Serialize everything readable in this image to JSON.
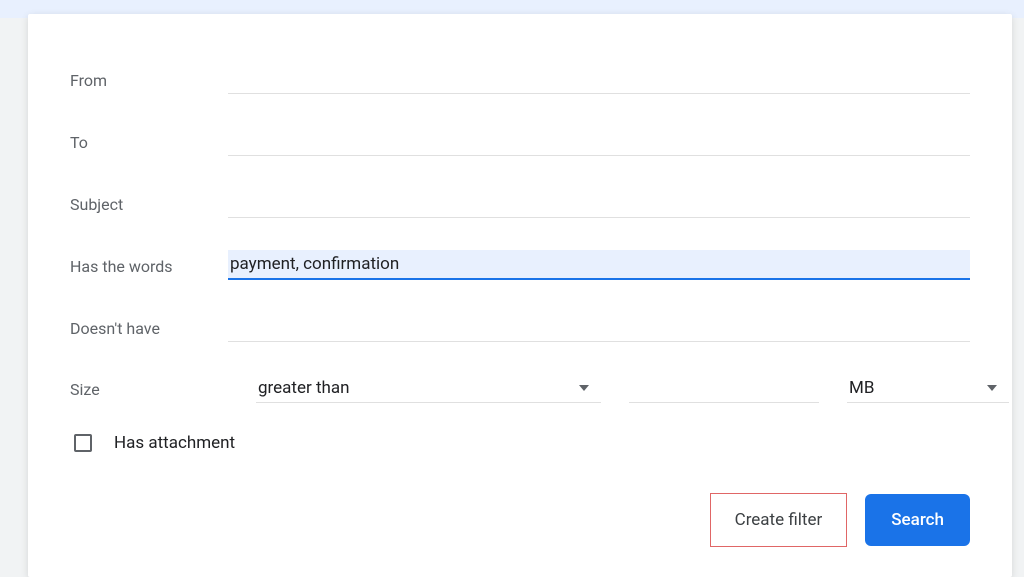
{
  "form": {
    "from_label": "From",
    "from_value": "",
    "to_label": "To",
    "to_value": "",
    "subject_label": "Subject",
    "subject_value": "",
    "has_words_label": "Has the words",
    "has_words_value": "payment, confirmation",
    "doesnt_have_label": "Doesn't have",
    "doesnt_have_value": "",
    "size_label": "Size",
    "size_comparison": "greater than",
    "size_amount": "",
    "size_unit": "MB",
    "has_attachment_label": "Has attachment",
    "has_attachment_checked": false
  },
  "buttons": {
    "create_filter": "Create filter",
    "search": "Search"
  }
}
